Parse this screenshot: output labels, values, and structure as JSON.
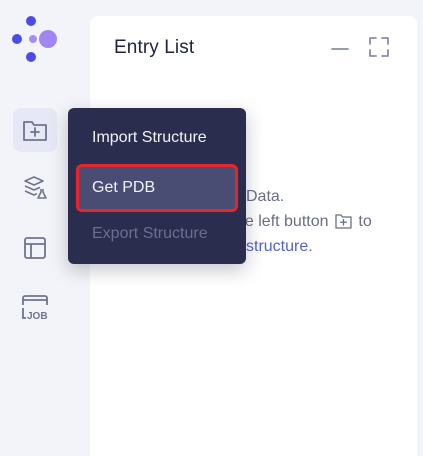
{
  "sidebar": {
    "logo": "app-logo",
    "items": [
      {
        "name": "import-folder-icon",
        "active": true
      },
      {
        "name": "molecule-flask-icon",
        "active": false
      },
      {
        "name": "layout-panel-icon",
        "active": false
      },
      {
        "name": "job-icon",
        "active": false,
        "label": "JOB"
      }
    ]
  },
  "panel": {
    "title": "Entry List",
    "empty_line1": "Data.",
    "empty_line2_a": "he left button",
    "empty_line2_b": "to",
    "empty_link": "structure",
    "empty_period": "."
  },
  "menu": {
    "items": [
      {
        "label": "Import Structure",
        "state": "normal"
      },
      {
        "label": "Get PDB",
        "state": "hover"
      },
      {
        "label": "Export Structure",
        "state": "disabled"
      }
    ]
  },
  "colors": {
    "accent": "#5562c9",
    "menu_bg": "#2b2d4f",
    "highlight": "#e5252a"
  }
}
